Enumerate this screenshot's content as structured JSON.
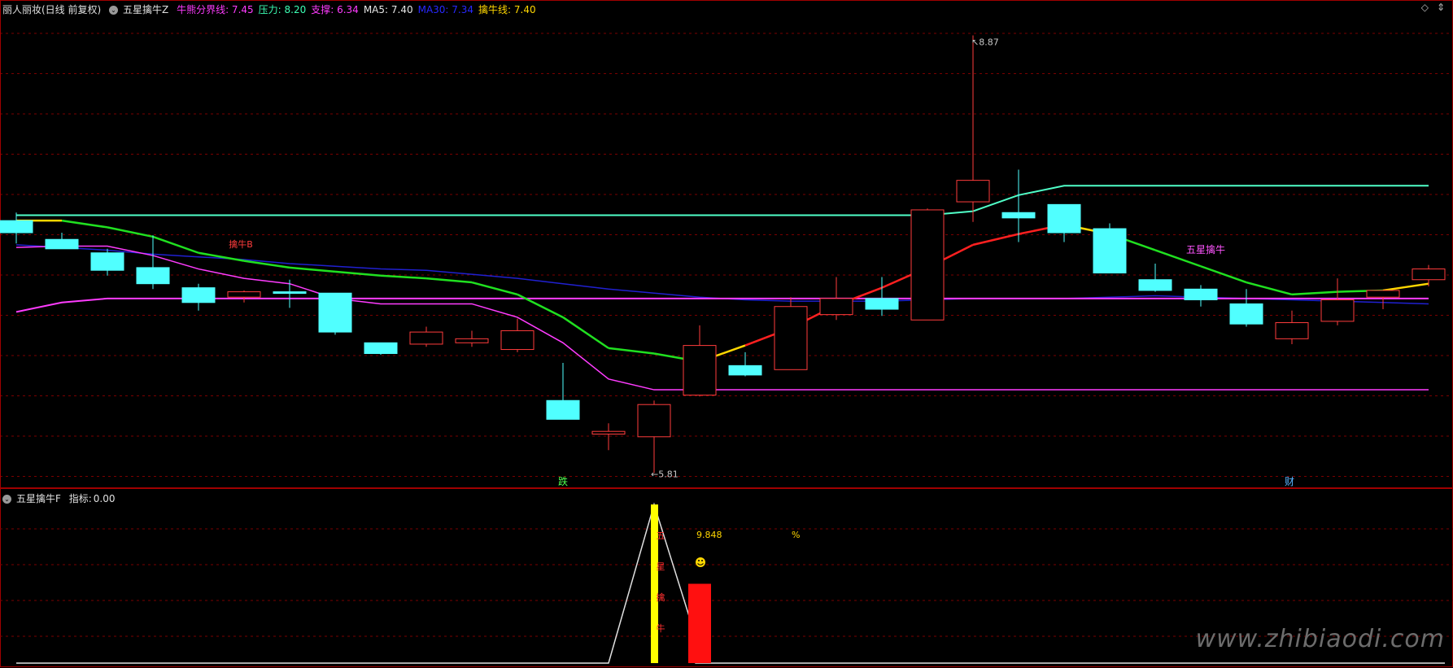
{
  "header": {
    "stock_name": "丽人丽妆(日线 前复权)",
    "indicator_name": "五星擒牛Z",
    "items": [
      {
        "label": "牛熊分界线:",
        "value": "7.45",
        "color": "#ff3cff"
      },
      {
        "label": "压力:",
        "value": "8.20",
        "color": "#3cffb4"
      },
      {
        "label": "支撑:",
        "value": "6.34",
        "color": "#ff3cff"
      },
      {
        "label": "MA5:",
        "value": "7.40",
        "color": "#e6e6e6"
      },
      {
        "label": "MA30:",
        "value": "7.34",
        "color": "#2828ff"
      },
      {
        "label": "擒牛线:",
        "value": "7.40",
        "color": "#ffd700"
      }
    ]
  },
  "sub_header": {
    "indicator_name": "五星擒牛F",
    "label": "指标:",
    "value": "0.00"
  },
  "watermark": "www.zhibiaodi.com",
  "colors": {
    "up": "#ff3c3c",
    "down": "#50ffff",
    "bull_line": "#ff3cff",
    "pressure": "#50ffc8",
    "ma30": "#2020d0",
    "grid": "#7a0000",
    "qn_red": "#ff2020",
    "qn_green": "#20e020",
    "qn_yellow": "#ffd700"
  },
  "chart_data": {
    "type": "candlestick",
    "price_range": [
      5.6,
      9.0
    ],
    "candles": [
      {
        "o": 7.49,
        "h": 7.55,
        "l": 7.32,
        "c": 7.4
      },
      {
        "o": 7.35,
        "h": 7.4,
        "l": 7.28,
        "c": 7.28
      },
      {
        "o": 7.25,
        "h": 7.28,
        "l": 7.08,
        "c": 7.12
      },
      {
        "o": 7.14,
        "h": 7.38,
        "l": 6.98,
        "c": 7.02
      },
      {
        "o": 6.99,
        "h": 7.02,
        "l": 6.82,
        "c": 6.88
      },
      {
        "o": 6.92,
        "h": 6.97,
        "l": 6.88,
        "c": 6.96
      },
      {
        "o": 6.96,
        "h": 7.05,
        "l": 6.84,
        "c": 6.95
      },
      {
        "o": 6.95,
        "h": 6.95,
        "l": 6.64,
        "c": 6.66
      },
      {
        "o": 6.58,
        "h": 6.58,
        "l": 6.49,
        "c": 6.5
      },
      {
        "o": 6.57,
        "h": 6.7,
        "l": 6.55,
        "c": 6.66
      },
      {
        "o": 6.58,
        "h": 6.67,
        "l": 6.55,
        "c": 6.61
      },
      {
        "o": 6.53,
        "h": 6.76,
        "l": 6.51,
        "c": 6.67
      },
      {
        "o": 6.15,
        "h": 6.43,
        "l": 6.01,
        "c": 6.01
      },
      {
        "o": 5.9,
        "h": 5.98,
        "l": 5.78,
        "c": 5.92
      },
      {
        "o": 5.88,
        "h": 6.15,
        "l": 5.61,
        "c": 6.12
      },
      {
        "o": 6.19,
        "h": 6.71,
        "l": 6.18,
        "c": 6.56
      },
      {
        "o": 6.41,
        "h": 6.51,
        "l": 6.33,
        "c": 6.34
      },
      {
        "o": 6.38,
        "h": 6.92,
        "l": 6.38,
        "c": 6.85
      },
      {
        "o": 6.79,
        "h": 7.07,
        "l": 6.75,
        "c": 6.91
      },
      {
        "o": 6.91,
        "h": 7.07,
        "l": 6.78,
        "c": 6.83
      },
      {
        "o": 6.75,
        "h": 7.58,
        "l": 6.75,
        "c": 7.57
      },
      {
        "o": 7.63,
        "h": 8.87,
        "l": 7.48,
        "c": 7.79
      },
      {
        "o": 7.55,
        "h": 7.87,
        "l": 7.33,
        "c": 7.51
      },
      {
        "o": 7.61,
        "h": 7.61,
        "l": 7.33,
        "c": 7.4
      },
      {
        "o": 7.43,
        "h": 7.47,
        "l": 7.1,
        "c": 7.1
      },
      {
        "o": 7.05,
        "h": 7.17,
        "l": 6.96,
        "c": 6.97
      },
      {
        "o": 6.98,
        "h": 7.01,
        "l": 6.85,
        "c": 6.9
      },
      {
        "o": 6.87,
        "h": 6.98,
        "l": 6.7,
        "c": 6.72
      },
      {
        "o": 6.61,
        "h": 6.82,
        "l": 6.57,
        "c": 6.73
      },
      {
        "o": 6.74,
        "h": 7.06,
        "l": 6.71,
        "c": 6.9
      },
      {
        "o": 6.92,
        "h": 6.97,
        "l": 6.83,
        "c": 6.97
      },
      {
        "o": 7.05,
        "h": 7.16,
        "l": 7.0,
        "c": 7.13
      }
    ],
    "lines": {
      "bull_bear": [
        7.29,
        7.3,
        7.3,
        7.23,
        7.13,
        7.06,
        7.02,
        6.91,
        6.87,
        6.87,
        6.87,
        6.77,
        6.58,
        6.31,
        6.23,
        6.23,
        6.23,
        6.23,
        6.23,
        6.23,
        6.23,
        6.23,
        6.23,
        6.23,
        6.23,
        6.23,
        6.23,
        6.23,
        6.23,
        6.23,
        6.23,
        6.23
      ],
      "pressure": [
        7.53,
        7.53,
        7.53,
        7.53,
        7.53,
        7.53,
        7.53,
        7.53,
        7.53,
        7.53,
        7.53,
        7.53,
        7.53,
        7.53,
        7.53,
        7.53,
        7.53,
        7.53,
        7.53,
        7.53,
        7.53,
        7.56,
        7.68,
        7.75,
        7.75,
        7.75,
        7.75,
        7.75,
        7.75,
        7.75,
        7.75,
        7.75
      ],
      "support": [
        6.81,
        6.88,
        6.91,
        6.91,
        6.91,
        6.91,
        6.91,
        6.91,
        6.91,
        6.91,
        6.91,
        6.91,
        6.91,
        6.91,
        6.91,
        6.91,
        6.91,
        6.91,
        6.91,
        6.91,
        6.91,
        6.91,
        6.91,
        6.91,
        6.91,
        6.91,
        6.91,
        6.91,
        6.91,
        6.91,
        6.91,
        6.91
      ],
      "ma30": [
        7.31,
        7.29,
        7.27,
        7.24,
        7.22,
        7.2,
        7.17,
        7.15,
        7.13,
        7.12,
        7.09,
        7.06,
        7.02,
        6.98,
        6.95,
        6.92,
        6.9,
        6.89,
        6.89,
        6.89,
        6.9,
        6.91,
        6.91,
        6.91,
        6.92,
        6.93,
        6.92,
        6.91,
        6.9,
        6.89,
        6.88,
        6.87
      ],
      "qinniu": [
        7.49,
        7.49,
        7.44,
        7.37,
        7.25,
        7.19,
        7.14,
        7.11,
        7.08,
        7.06,
        7.03,
        6.94,
        6.77,
        6.54,
        6.5,
        6.44,
        6.56,
        6.69,
        6.86,
        6.99,
        7.14,
        7.31,
        7.39,
        7.46,
        7.39,
        7.27,
        7.15,
        7.03,
        6.94,
        6.96,
        6.97,
        7.02
      ],
      "qinniu_colors": [
        "y",
        "y",
        "g",
        "g",
        "g",
        "g",
        "g",
        "g",
        "g",
        "g",
        "g",
        "g",
        "g",
        "g",
        "g",
        "g",
        "y",
        "r",
        "r",
        "r",
        "r",
        "r",
        "r",
        "r",
        "y",
        "g",
        "g",
        "g",
        "g",
        "g",
        "g",
        "y"
      ]
    },
    "annotations": {
      "high_label": "8.87",
      "low_label": "5.81",
      "fall_label": "跌",
      "cai_label": "财",
      "qinniu_b_label": "擒牛B",
      "five_star_label": "五星擒牛"
    },
    "sub_chart": {
      "value_label": "9.848",
      "percent_label": "%",
      "smile_icon": "smile-icon",
      "vertical_text": [
        "五",
        "星",
        "擒",
        "牛"
      ],
      "peak_value": 1.0,
      "red_bar_value": 0.5
    }
  }
}
